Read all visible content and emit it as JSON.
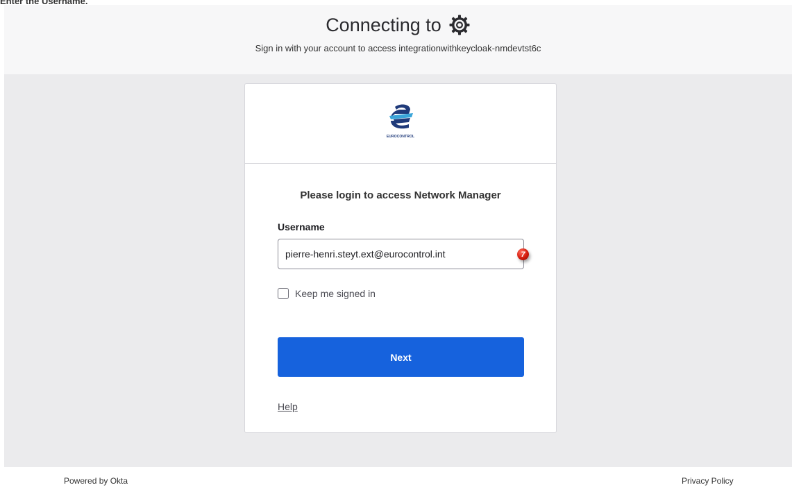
{
  "instruction": {
    "text": "Enter the Username."
  },
  "header": {
    "title": "Connecting to",
    "app_icon": "gear-icon",
    "subtitle": "Sign in with your account to access integrationwithkeycloak-nmdevtst6c"
  },
  "card": {
    "logo": {
      "name": "eurocontrol-logo",
      "text": "EUROCONTROL"
    },
    "heading": "Please login to access Network Manager",
    "username_label": "Username",
    "username_value": "pierre-henri.steyt.ext@eurocontrol.int",
    "step_marker": "7",
    "keep_signed_in_label": "Keep me signed in",
    "keep_signed_in_checked": false,
    "next_label": "Next",
    "help_label": "Help"
  },
  "footer": {
    "powered_by": "Powered by Okta",
    "privacy": "Privacy Policy"
  },
  "colors": {
    "primary_button": "#1662dd",
    "page_background": "#ebebed",
    "header_background": "#f7f7f8",
    "marker": "#d31c0d"
  }
}
